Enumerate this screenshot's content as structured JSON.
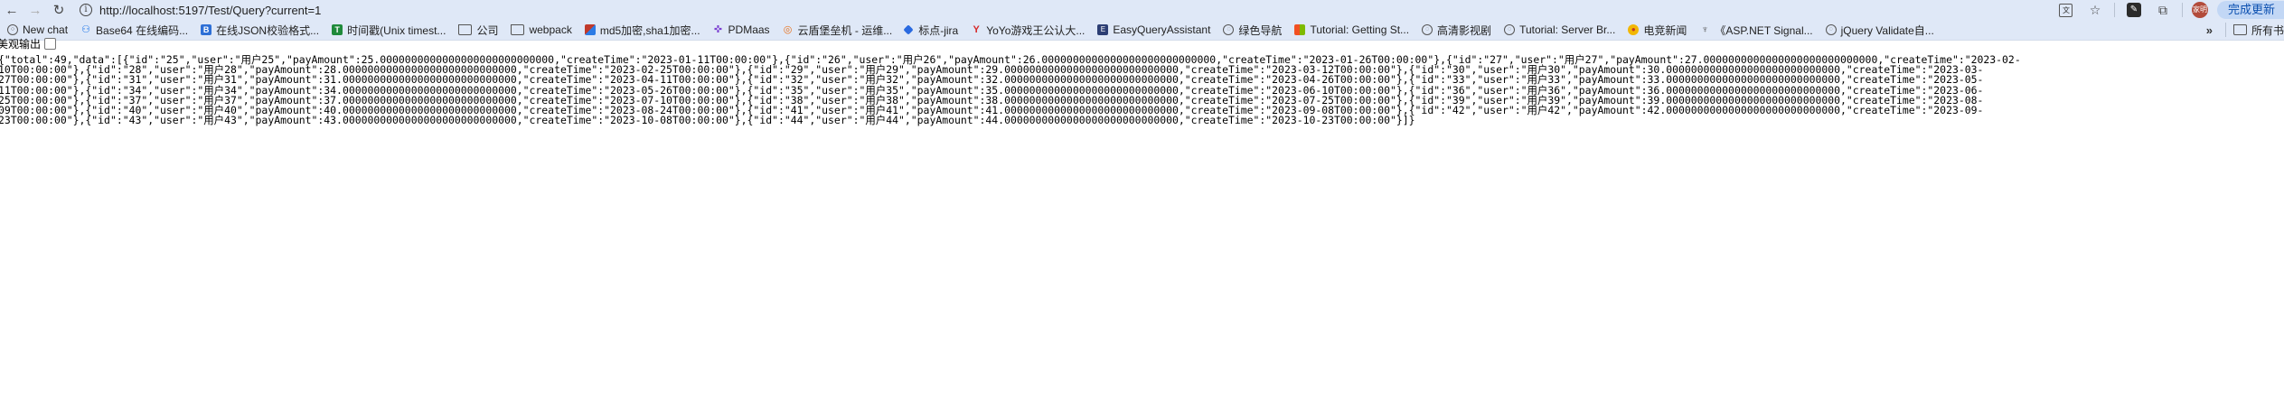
{
  "browser": {
    "url": "http://localhost:5197/Test/Query?current=1",
    "update_label": "完成更新",
    "profile_initials": "家明"
  },
  "bookmarks": {
    "items": [
      {
        "label": "New chat",
        "icon": "chat-icon"
      },
      {
        "label": "Base64 在线编码...",
        "icon": "base64-icon"
      },
      {
        "label": "在线JSON校验格式...",
        "icon": "json-icon"
      },
      {
        "label": "时间戳(Unix timest...",
        "icon": "timestamp-icon"
      },
      {
        "label": "公司",
        "icon": "folder-icon"
      },
      {
        "label": "webpack",
        "icon": "folder-icon"
      },
      {
        "label": "md5加密,sha1加密...",
        "icon": "md5-icon"
      },
      {
        "label": "PDMaas",
        "icon": "pdmaas-icon"
      },
      {
        "label": "云盾堡垒机 - 运维...",
        "icon": "cloud-icon"
      },
      {
        "label": "标点-jira",
        "icon": "jira-icon"
      },
      {
        "label": "YoYo游戏王公认大...",
        "icon": "yoyo-icon"
      },
      {
        "label": "EasyQueryAssistant",
        "icon": "easyquery-icon"
      },
      {
        "label": "绿色导航",
        "icon": "globe-icon"
      },
      {
        "label": "Tutorial: Getting St...",
        "icon": "microsoft-icon"
      },
      {
        "label": "高清影视剧",
        "icon": "film-icon"
      },
      {
        "label": "Tutorial: Server Br...",
        "icon": "globe-icon"
      },
      {
        "label": "电竞新闻",
        "icon": "news-icon"
      },
      {
        "label": "《ASP.NET Signal...",
        "icon": "asp-icon"
      },
      {
        "label": "jQuery Validate自...",
        "icon": "globe-icon"
      }
    ],
    "all_bookmarks_label": "所有书"
  },
  "page": {
    "pretty_print_label": "美观输出",
    "json_lines": [
      "{\"total\":49,\"data\":[{\"id\":\"25\",\"user\":\"用户25\",\"payAmount\":25.0000000000000000000000000000,\"createTime\":\"2023-01-11T00:00:00\"},{\"id\":\"26\",\"user\":\"用户26\",\"payAmount\":26.0000000000000000000000000000,\"createTime\":\"2023-01-26T00:00:00\"},{\"id\":\"27\",\"user\":\"用户27\",\"payAmount\":27.0000000000000000000000000000,\"createTime\":\"2023-02-",
      "10T00:00:00\"},{\"id\":\"28\",\"user\":\"用户28\",\"payAmount\":28.0000000000000000000000000000,\"createTime\":\"2023-02-25T00:00:00\"},{\"id\":\"29\",\"user\":\"用户29\",\"payAmount\":29.0000000000000000000000000000,\"createTime\":\"2023-03-12T00:00:00\"},{\"id\":\"30\",\"user\":\"用户30\",\"payAmount\":30.0000000000000000000000000000,\"createTime\":\"2023-03-",
      "27T00:00:00\"},{\"id\":\"31\",\"user\":\"用户31\",\"payAmount\":31.0000000000000000000000000000,\"createTime\":\"2023-04-11T00:00:00\"},{\"id\":\"32\",\"user\":\"用户32\",\"payAmount\":32.0000000000000000000000000000,\"createTime\":\"2023-04-26T00:00:00\"},{\"id\":\"33\",\"user\":\"用户33\",\"payAmount\":33.0000000000000000000000000000,\"createTime\":\"2023-05-",
      "11T00:00:00\"},{\"id\":\"34\",\"user\":\"用户34\",\"payAmount\":34.0000000000000000000000000000,\"createTime\":\"2023-05-26T00:00:00\"},{\"id\":\"35\",\"user\":\"用户35\",\"payAmount\":35.0000000000000000000000000000,\"createTime\":\"2023-06-10T00:00:00\"},{\"id\":\"36\",\"user\":\"用户36\",\"payAmount\":36.0000000000000000000000000000,\"createTime\":\"2023-06-",
      "25T00:00:00\"},{\"id\":\"37\",\"user\":\"用户37\",\"payAmount\":37.0000000000000000000000000000,\"createTime\":\"2023-07-10T00:00:00\"},{\"id\":\"38\",\"user\":\"用户38\",\"payAmount\":38.0000000000000000000000000000,\"createTime\":\"2023-07-25T00:00:00\"},{\"id\":\"39\",\"user\":\"用户39\",\"payAmount\":39.0000000000000000000000000000,\"createTime\":\"2023-08-",
      "09T00:00:00\"},{\"id\":\"40\",\"user\":\"用户40\",\"payAmount\":40.0000000000000000000000000000,\"createTime\":\"2023-08-24T00:00:00\"},{\"id\":\"41\",\"user\":\"用户41\",\"payAmount\":41.0000000000000000000000000000,\"createTime\":\"2023-09-08T00:00:00\"},{\"id\":\"42\",\"user\":\"用户42\",\"payAmount\":42.0000000000000000000000000000,\"createTime\":\"2023-09-",
      "23T00:00:00\"},{\"id\":\"43\",\"user\":\"用户43\",\"payAmount\":43.0000000000000000000000000000,\"createTime\":\"2023-10-08T00:00:00\"},{\"id\":\"44\",\"user\":\"用户44\",\"payAmount\":44.0000000000000000000000000000,\"createTime\":\"2023-10-23T00:00:00\"}]}"
    ]
  }
}
